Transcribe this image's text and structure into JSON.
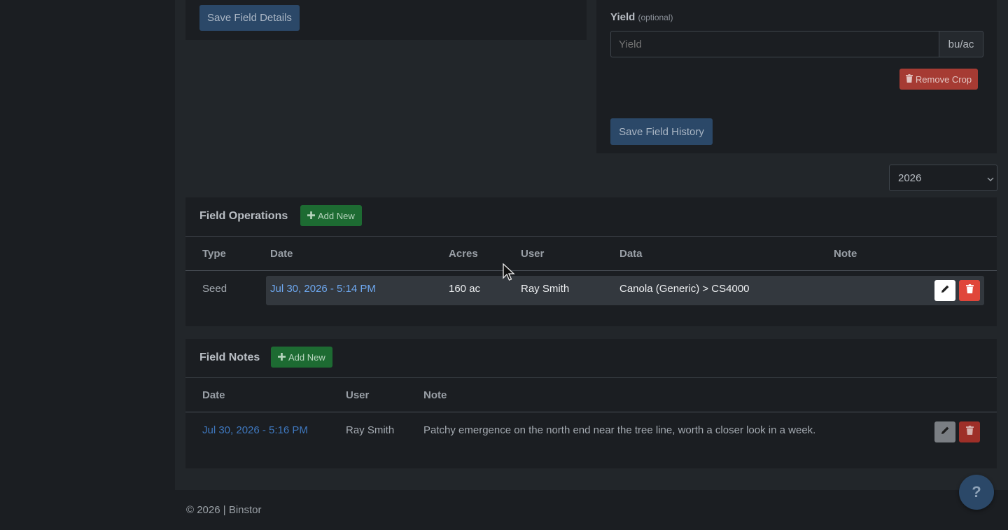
{
  "field_details": {
    "save_label": "Save Field Details"
  },
  "field_history": {
    "yield_label": "Yield",
    "yield_optional": "(optional)",
    "yield_placeholder": "Yield",
    "yield_unit": "bu/ac",
    "remove_crop_label": "Remove Crop",
    "save_label": "Save Field History"
  },
  "year_select": {
    "value": "2026"
  },
  "operations": {
    "title": "Field Operations",
    "add_new_label": "Add New",
    "headers": {
      "type": "Type",
      "date": "Date",
      "acres": "Acres",
      "user": "User",
      "data": "Data",
      "note": "Note"
    },
    "rows": [
      {
        "type": "Seed",
        "date": "Jul 30, 2026 - 5:14 PM",
        "acres": "160 ac",
        "user": "Ray Smith",
        "data": "Canola (Generic) > CS4000",
        "note": ""
      }
    ]
  },
  "notes": {
    "title": "Field Notes",
    "add_new_label": "Add New",
    "headers": {
      "date": "Date",
      "user": "User",
      "note": "Note"
    },
    "rows": [
      {
        "date": "Jul 30, 2026 - 5:16 PM",
        "user": "Ray Smith",
        "note": "Patchy emergence on the north end near the tree line, worth a closer look in a week."
      }
    ]
  },
  "footer": {
    "text": "© 2026 | Binstor"
  },
  "help": {
    "label": "?"
  },
  "colors": {
    "accent_blue": "#2b4868",
    "green": "#1d6b32",
    "red": "#a63b33",
    "link": "#6ea8f0"
  }
}
